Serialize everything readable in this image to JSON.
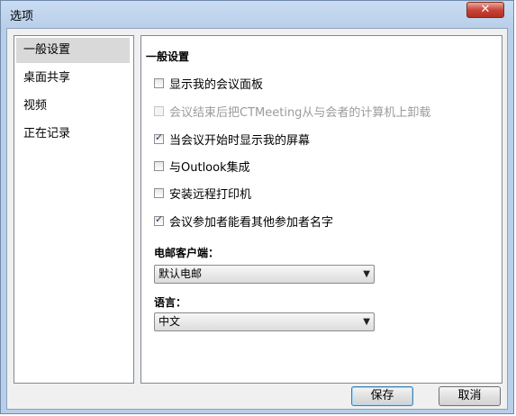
{
  "window": {
    "title": "选项",
    "close_glyph": "✕"
  },
  "sidebar": {
    "items": [
      {
        "label": "一般设置",
        "selected": true
      },
      {
        "label": "桌面共享",
        "selected": false
      },
      {
        "label": "视频",
        "selected": false
      },
      {
        "label": "正在记录",
        "selected": false
      }
    ]
  },
  "general": {
    "title": "一般设置",
    "options": [
      {
        "label": "显示我的会议面板",
        "checked": false,
        "enabled": true
      },
      {
        "label": "会议结束后把CTMeeting从与会者的计算机上卸载",
        "checked": false,
        "enabled": false
      },
      {
        "label": "当会议开始时显示我的屏幕",
        "checked": true,
        "enabled": true
      },
      {
        "label": "与Outlook集成",
        "checked": false,
        "enabled": true
      },
      {
        "label": "安装远程打印机",
        "checked": false,
        "enabled": true
      },
      {
        "label": "会议参加者能看其他参加者名字",
        "checked": true,
        "enabled": true
      }
    ],
    "email_client": {
      "label": "电邮客户端：",
      "value": "默认电邮"
    },
    "language": {
      "label": "语言：",
      "value": "中文"
    }
  },
  "buttons": {
    "save": "保存",
    "cancel": "取消"
  },
  "icons": {
    "dropdown": "chevron-down-icon",
    "close": "close-icon",
    "check": "checkmark-icon"
  }
}
